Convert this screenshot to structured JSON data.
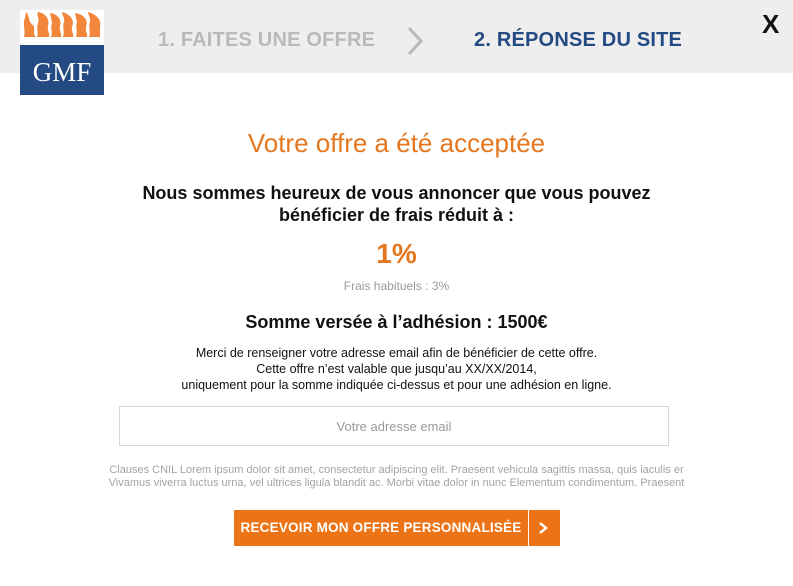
{
  "header": {
    "logo_text": "GMF",
    "step_1": "1. FAITES UNE OFFRE",
    "step_2": "2. RÉPONSE DU SITE",
    "close_label": "X"
  },
  "offer": {
    "title": "Votre offre a été acceptée",
    "lead_line_1": "Nous sommes heureux de vous annoncer que vous pouvez",
    "lead_line_2": "bénéficier de frais réduit à :",
    "rate": "1%",
    "usual_fees": "Frais habituels : 3%",
    "amount": "Somme versée à l’adhésion : 1500€",
    "info_line_1": "Merci de renseigner votre adresse email afin de bénéficier de cette offre.",
    "info_line_2": "Cette offre n’est valable que jusqu’au XX/XX/2014,",
    "info_line_3": "uniquement pour la somme indiquée ci-dessus et pour une adhésion en ligne."
  },
  "form": {
    "email_value": "",
    "email_placeholder": "Votre adresse email",
    "legal_line_1": "Clauses CNIL Lorem ipsum dolor sit amet, consectetur adipiscing elit. Praesent vehicula sagittis massa, quis iaculis er",
    "legal_line_2": "Vivamus viverra luctus urna, vel ultrices ligula blandit ac. Morbi vitae dolor in nunc Elementum condimentum. Praesent",
    "submit_label": "RECEVOIR MON OFFRE PERSONNALISÉE"
  },
  "colors": {
    "accent": "#ec7416",
    "title": "#e5771e",
    "brand_blue": "#234a82",
    "step_inactive": "#b9b9b9",
    "topbar": "#eeeeee"
  },
  "icons": {
    "logo": "gmf-logo",
    "step_separator": "chevron-right-icon",
    "close": "close-icon",
    "submit_arrow": "chevron-right-icon"
  }
}
